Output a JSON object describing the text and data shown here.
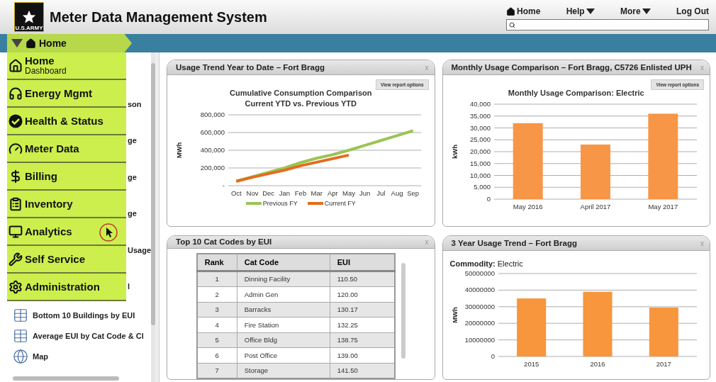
{
  "header": {
    "logo_text": "U.S.ARMY",
    "title": "Meter Data Management System",
    "nav": [
      {
        "label": "Home",
        "kind": "home"
      },
      {
        "label": "Help",
        "kind": "dropdown"
      },
      {
        "label": "More",
        "kind": "dropdown"
      },
      {
        "label": "Log Out",
        "kind": "plain"
      }
    ]
  },
  "breadcrumb": {
    "label": "Home"
  },
  "sidebar": {
    "items": [
      {
        "label": "son",
        "kind": "partial"
      },
      {
        "label": "ge",
        "kind": "partial"
      },
      {
        "label": "ge",
        "kind": "partial"
      },
      {
        "label": "ge",
        "kind": "partial"
      },
      {
        "label": "Usage",
        "kind": "partial"
      },
      {
        "label": "l",
        "kind": "partial"
      },
      {
        "label": "Bottom 10 Buildings by EUI",
        "kind": "table"
      },
      {
        "label": "Average EUI by Cat Code & Cl",
        "kind": "table"
      },
      {
        "label": "Map",
        "kind": "map"
      }
    ]
  },
  "menu": {
    "items": [
      {
        "label": "Home",
        "sublabel": "Dashboard",
        "kind": "home",
        "pointed": false
      },
      {
        "label": "Energy Mgmt",
        "kind": "energy",
        "pointed": false
      },
      {
        "label": "Health & Status",
        "kind": "health",
        "pointed": false
      },
      {
        "label": "Meter Data",
        "kind": "meter",
        "pointed": false
      },
      {
        "label": "Billing",
        "kind": "billing",
        "pointed": false
      },
      {
        "label": "Inventory",
        "kind": "inventory",
        "pointed": false
      },
      {
        "label": "Analytics",
        "kind": "analytics",
        "pointed": true
      },
      {
        "label": "Self Service",
        "kind": "service",
        "pointed": false
      },
      {
        "label": "Administration",
        "kind": "admin",
        "pointed": false
      }
    ]
  },
  "panels": [
    {
      "kind": "chart",
      "title": "Usage Trend Year to Date – Fort Bragg",
      "close": "x",
      "button": "View report options",
      "chart_data": {
        "type": "line",
        "title": "Cumulative Consumption Comparison Current YTD vs. Previous YTD",
        "ylabel": "MWh",
        "categories": [
          "Oct",
          "Nov",
          "Dec",
          "Jan",
          "Feb",
          "Mar",
          "Apr",
          "May",
          "Jun",
          "Jul",
          "Aug",
          "Sep"
        ],
        "ylim": [
          0,
          800000
        ],
        "yticks": [
          {
            "value": 0,
            "label": "-"
          },
          {
            "value": 200000,
            "label": "200,000"
          },
          {
            "value": 400000,
            "label": "400,000"
          },
          {
            "value": 600000,
            "label": "600,000"
          },
          {
            "value": 800000,
            "label": "800,000"
          }
        ],
        "series": [
          {
            "name": "Previous FY",
            "color": "#9bc455",
            "values": [
              50000,
              100000,
              150000,
              200000,
              260000,
              310000,
              350000,
              400000,
              455000,
              510000,
              565000,
              620000
            ]
          },
          {
            "name": "Current FY",
            "color": "#e46c1e",
            "values": [
              50000,
              95000,
              135000,
              175000,
              225000,
              265000,
              305000,
              345000,
              null,
              null,
              null,
              null
            ]
          }
        ],
        "grid": true
      }
    },
    {
      "kind": "chart",
      "title": "Monthly Usage Comparison – Fort Bragg, C5726 Enlisted UPH",
      "close": "x",
      "button": "View report options",
      "chart_data": {
        "type": "bar",
        "title": "Monthly Usage Comparison: Electric",
        "ylabel": "kWh",
        "categories": [
          "May 2016",
          "April 2017",
          "May 2017"
        ],
        "ylim": [
          0,
          40000
        ],
        "yticks": [
          {
            "value": 0,
            "label": "0"
          },
          {
            "value": 5000,
            "label": "5,000"
          },
          {
            "value": 10000,
            "label": "10,000"
          },
          {
            "value": 15000,
            "label": "15,000"
          },
          {
            "value": 20000,
            "label": "20,000"
          },
          {
            "value": 25000,
            "label": "25,000"
          },
          {
            "value": 30000,
            "label": "30,000"
          },
          {
            "value": 35000,
            "label": "35,000"
          },
          {
            "value": 40000,
            "label": "40,000"
          }
        ],
        "series": [
          {
            "color": "#f79646",
            "values": [
              32000,
              23000,
              36000
            ]
          }
        ],
        "grid": true
      }
    },
    {
      "kind": "table",
      "title": "Top 10 Cat Codes by EUI",
      "close": "x",
      "table": {
        "columns": [
          "Rank",
          "Cat Code",
          "EUI"
        ],
        "rows": [
          [
            "1",
            "Dinning Facility",
            "110.50"
          ],
          [
            "2",
            "Admin Gen",
            "120.00"
          ],
          [
            "3",
            "Barracks",
            "130.17"
          ],
          [
            "4",
            "Fire Station",
            "132.25"
          ],
          [
            "5",
            "Office Bldg",
            "138.75"
          ],
          [
            "6",
            "Post Office",
            "139.00"
          ],
          [
            "7",
            "Storage",
            "141.50"
          ]
        ]
      }
    },
    {
      "kind": "chart",
      "title": "3 Year Usage Trend – Fort Bragg",
      "close": "x",
      "commodity": "**Commodity:** Electric",
      "chart_data": {
        "type": "bar",
        "ylabel": "MWh",
        "categories": [
          "2015",
          "2016",
          "2017"
        ],
        "ylim": [
          0,
          50000000
        ],
        "yticks": [
          0,
          10000000,
          20000000,
          30000000,
          40000000,
          50000000
        ],
        "series": [
          {
            "color": "#f7963c",
            "values": [
              35000000,
              39000000,
              29500000
            ]
          }
        ],
        "grid": true
      }
    }
  ]
}
